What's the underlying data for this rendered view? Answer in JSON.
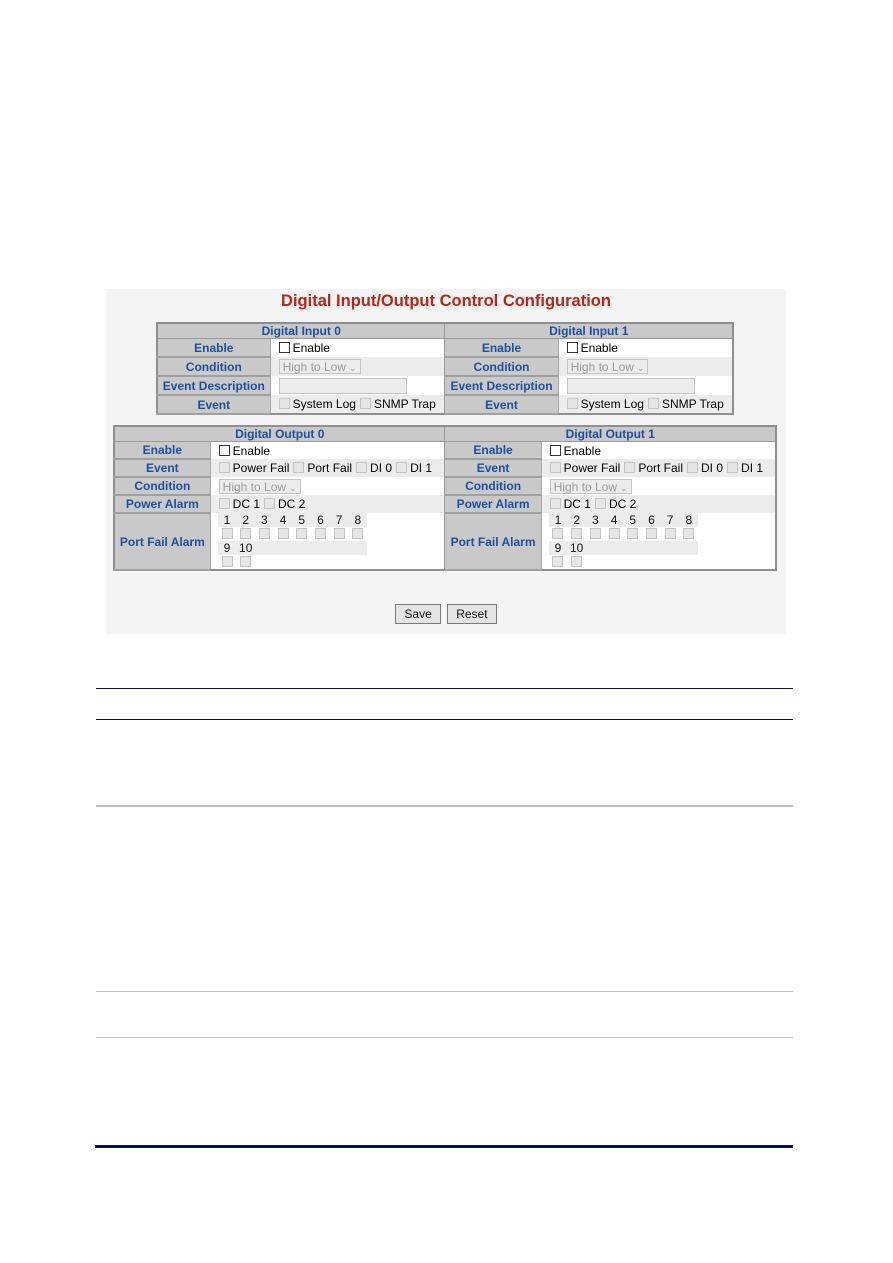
{
  "page": {
    "title": "Digital Input/Output Control Configuration",
    "colors": {
      "title": "#b5261c",
      "label_text": "#1d4f9c",
      "label_bg": "#c9c9c9",
      "panel_bg": "#f4f4f4",
      "rule_navy": "#0b0b5c",
      "rule_gray": "#c0c0c0"
    }
  },
  "inputs": [
    {
      "header": "Digital Input 0",
      "enable_label": "Enable",
      "enable_checkbox_label": "Enable",
      "enable_checked": false,
      "condition_label": "Condition",
      "condition_value": "High to Low",
      "event_description_label": "Event Description",
      "event_description_value": "",
      "event_label": "Event",
      "event_options": [
        {
          "label": "System Log",
          "checked": false,
          "disabled": true
        },
        {
          "label": "SNMP Trap",
          "checked": false,
          "disabled": true
        }
      ]
    },
    {
      "header": "Digital Input 1",
      "enable_label": "Enable",
      "enable_checkbox_label": "Enable",
      "enable_checked": false,
      "condition_label": "Condition",
      "condition_value": "High to Low",
      "event_description_label": "Event Description",
      "event_description_value": "",
      "event_label": "Event",
      "event_options": [
        {
          "label": "System Log",
          "checked": false,
          "disabled": true
        },
        {
          "label": "SNMP Trap",
          "checked": false,
          "disabled": true
        }
      ]
    }
  ],
  "outputs": [
    {
      "header": "Digital Output 0",
      "enable_label": "Enable",
      "enable_checkbox_label": "Enable",
      "event_label": "Event",
      "event_options": [
        "Power Fail",
        "Port Fail",
        "DI 0",
        "DI 1"
      ],
      "condition_label": "Condition",
      "condition_value": "High to Low",
      "power_alarm_label": "Power Alarm",
      "power_alarm_options": [
        "DC 1",
        "DC 2"
      ],
      "port_fail_alarm_label": "Port Fail Alarm",
      "ports_row1": [
        "1",
        "2",
        "3",
        "4",
        "5",
        "6",
        "7",
        "8"
      ],
      "ports_row2": [
        "9",
        "10"
      ]
    },
    {
      "header": "Digital Output 1",
      "enable_label": "Enable",
      "enable_checkbox_label": "Enable",
      "event_label": "Event",
      "event_options": [
        "Power Fail",
        "Port Fail",
        "DI 0",
        "DI 1"
      ],
      "condition_label": "Condition",
      "condition_value": "High to Low",
      "power_alarm_label": "Power Alarm",
      "power_alarm_options": [
        "DC 1",
        "DC 2"
      ],
      "port_fail_alarm_label": "Port Fail Alarm",
      "ports_row1": [
        "1",
        "2",
        "3",
        "4",
        "5",
        "6",
        "7",
        "8"
      ],
      "ports_row2": [
        "9",
        "10"
      ]
    }
  ],
  "buttons": {
    "save": "Save",
    "reset": "Reset"
  }
}
